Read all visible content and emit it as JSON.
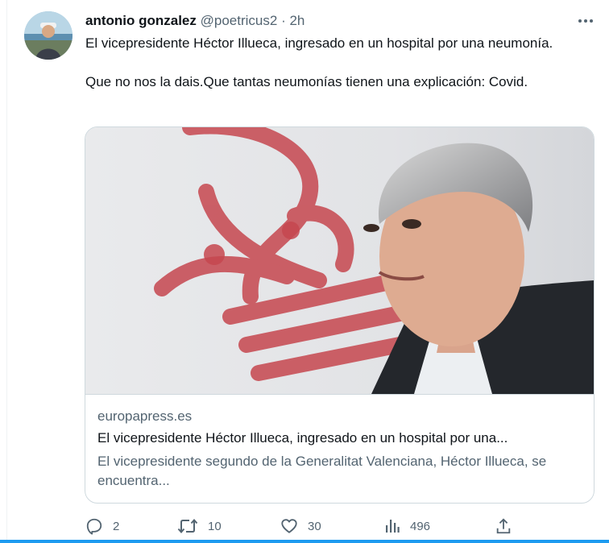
{
  "tweet": {
    "author": {
      "display_name": "antonio gonzalez",
      "handle": "@poetricus2"
    },
    "separator": "·",
    "time": "2h",
    "paragraphs": [
      "El vicepresidente Héctor Illueca, ingresado en un hospital por una neumonía.",
      "Que no nos la dais.Que tantas neumonías tienen una explicación: Covid."
    ]
  },
  "card": {
    "domain": "europapress.es",
    "title": "El vicepresidente Héctor Illueca, ingresado en un hospital por una...",
    "description": "El vicepresidente segundo de la Generalitat Valenciana, Héctor Illueca, se encuentra..."
  },
  "actions": {
    "reply": {
      "icon": "reply-icon",
      "count": "2"
    },
    "retweet": {
      "icon": "retweet-icon",
      "count": "10"
    },
    "like": {
      "icon": "heart-icon",
      "count": "30"
    },
    "views": {
      "icon": "views-icon",
      "count": "496"
    },
    "share": {
      "icon": "share-icon"
    }
  },
  "colors": {
    "text": "#0f1419",
    "secondary": "#536471",
    "border": "#cfd9de",
    "accent": "#1d9bf0",
    "emblem_red": "#c6474f"
  }
}
